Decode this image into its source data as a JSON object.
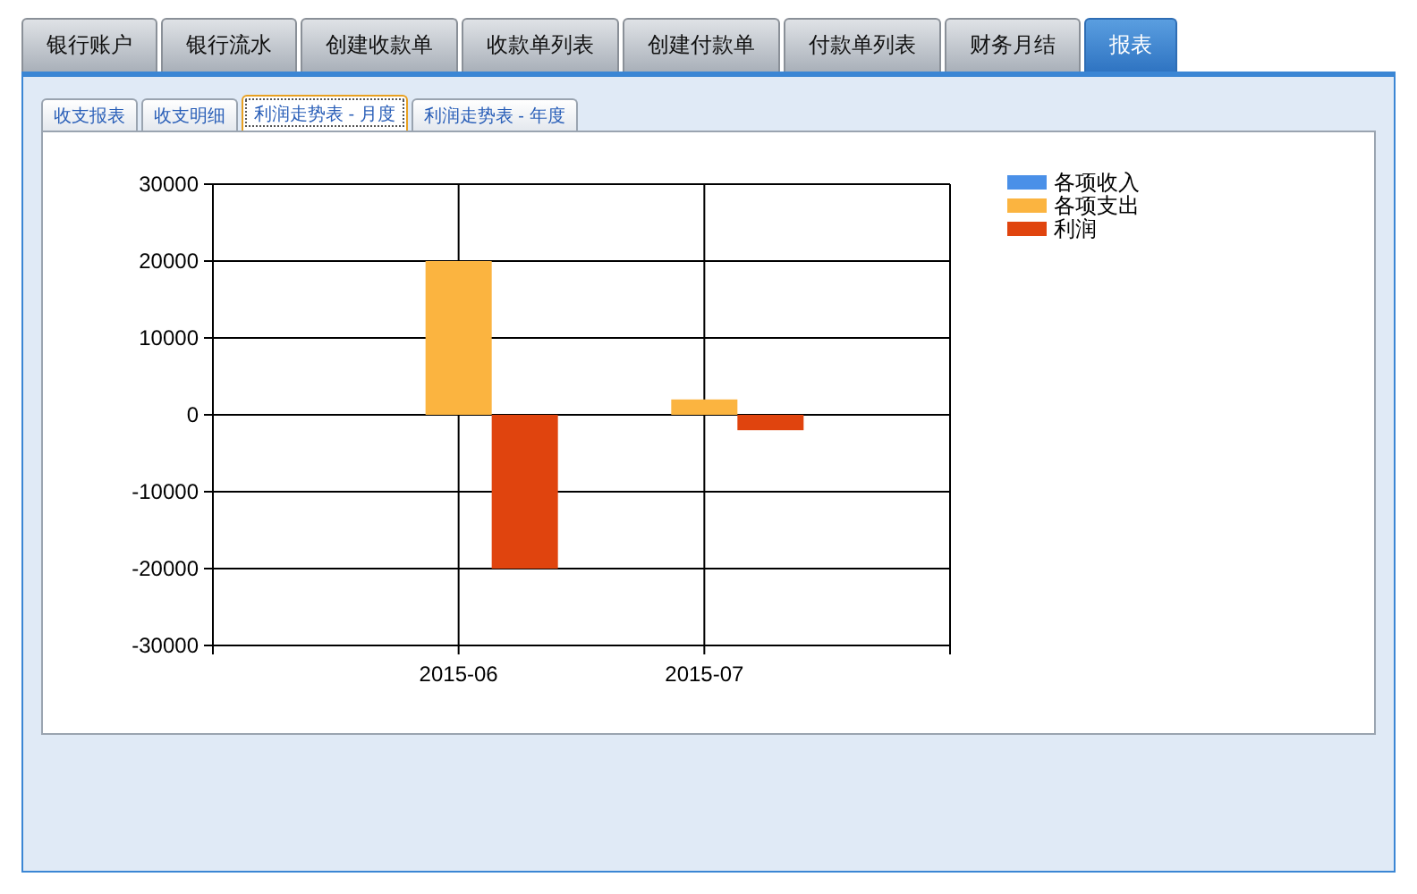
{
  "tabs": [
    {
      "label": "银行账户",
      "selected": false
    },
    {
      "label": "银行流水",
      "selected": false
    },
    {
      "label": "创建收款单",
      "selected": false
    },
    {
      "label": "收款单列表",
      "selected": false
    },
    {
      "label": "创建付款单",
      "selected": false
    },
    {
      "label": "付款单列表",
      "selected": false
    },
    {
      "label": "财务月结",
      "selected": false
    },
    {
      "label": "报表",
      "selected": true
    }
  ],
  "report_tabs": [
    {
      "label": "收支报表",
      "selected": false
    },
    {
      "label": "收支明细",
      "selected": false
    },
    {
      "label": "利润走势表 - 月度",
      "selected": true
    },
    {
      "label": "利润走势表 - 年度",
      "selected": false
    }
  ],
  "chart_data": {
    "type": "bar",
    "grid": true,
    "legend": true,
    "categories": [
      "2015-06",
      "2015-07"
    ],
    "ylim": [
      -30000,
      30000
    ],
    "yticks": [
      -30000,
      -20000,
      -10000,
      0,
      10000,
      20000,
      30000
    ],
    "series": [
      {
        "name": "各项收入",
        "color": "#4a90e8",
        "values": [
          0,
          0
        ]
      },
      {
        "name": "各项支出",
        "color": "#fbb440",
        "values": [
          20000,
          2000
        ]
      },
      {
        "name": "利润",
        "color": "#e0440e",
        "values": [
          -20000,
          -2000
        ]
      }
    ]
  }
}
